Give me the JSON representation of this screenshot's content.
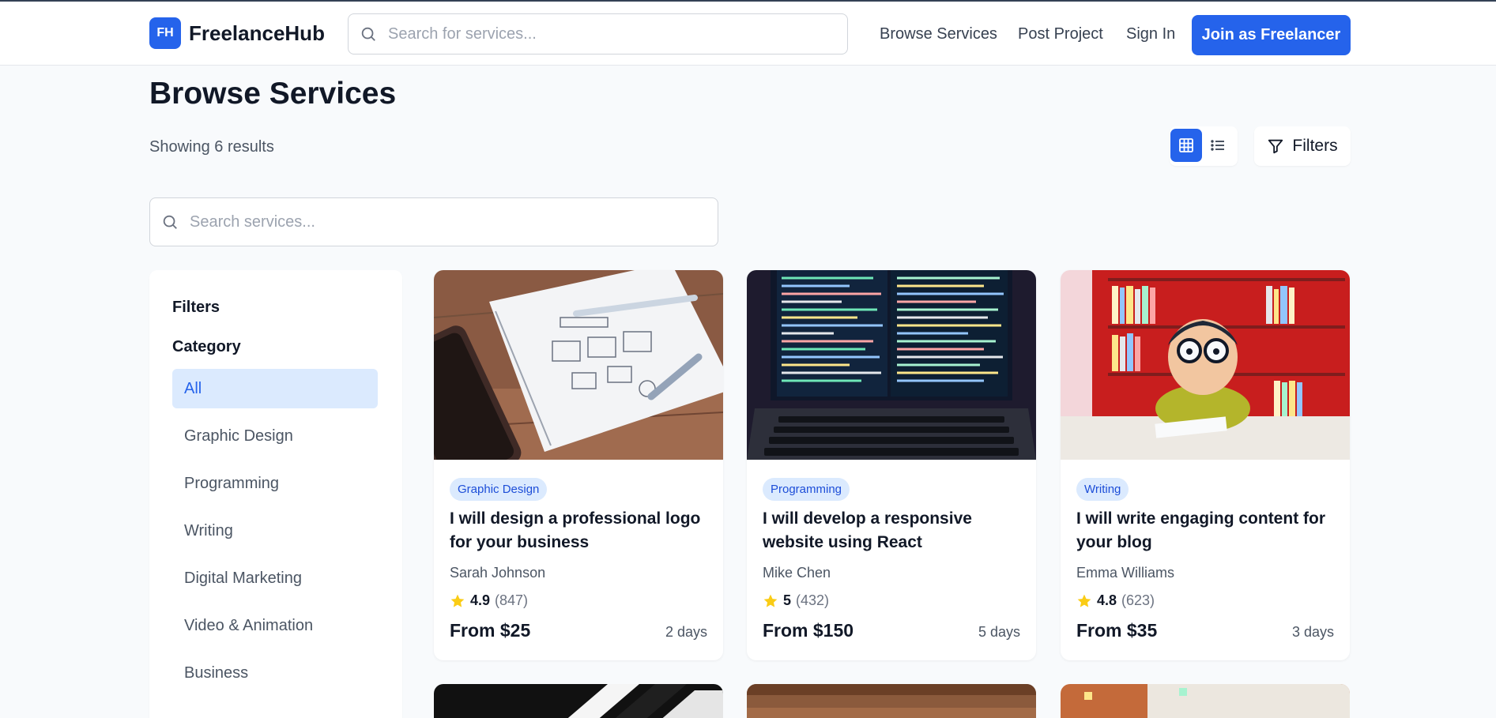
{
  "header": {
    "logo_mark": "FH",
    "logo_text": "FreelanceHub",
    "search_placeholder": "Search for services...",
    "nav": [
      "Browse Services",
      "Post Project",
      "Sign In"
    ],
    "join_label": "Join as Freelancer"
  },
  "page": {
    "title": "Browse Services",
    "results": "Showing 6 results",
    "filters_label": "Filters",
    "search_placeholder": "Search services..."
  },
  "sidebar": {
    "title": "Filters",
    "category_title": "Category",
    "categories": [
      "All",
      "Graphic Design",
      "Programming",
      "Writing",
      "Digital Marketing",
      "Video & Animation",
      "Business"
    ],
    "active_category": "All"
  },
  "services": [
    {
      "category": "Graphic Design",
      "title": "I will design a professional logo for your business",
      "seller": "Sarah Johnson",
      "rating": "4.9",
      "reviews": "(847)",
      "price": "From $25",
      "delivery": "2 days"
    },
    {
      "category": "Programming",
      "title": "I will develop a responsive website using React",
      "seller": "Mike Chen",
      "rating": "5",
      "reviews": "(432)",
      "price": "From $150",
      "delivery": "5 days"
    },
    {
      "category": "Writing",
      "title": "I will write engaging content for your blog",
      "seller": "Emma Williams",
      "rating": "4.8",
      "reviews": "(623)",
      "price": "From $35",
      "delivery": "3 days"
    }
  ],
  "colors": {
    "accent": "#2563eb",
    "badge_bg": "#dbeafe",
    "star": "#facc15"
  }
}
